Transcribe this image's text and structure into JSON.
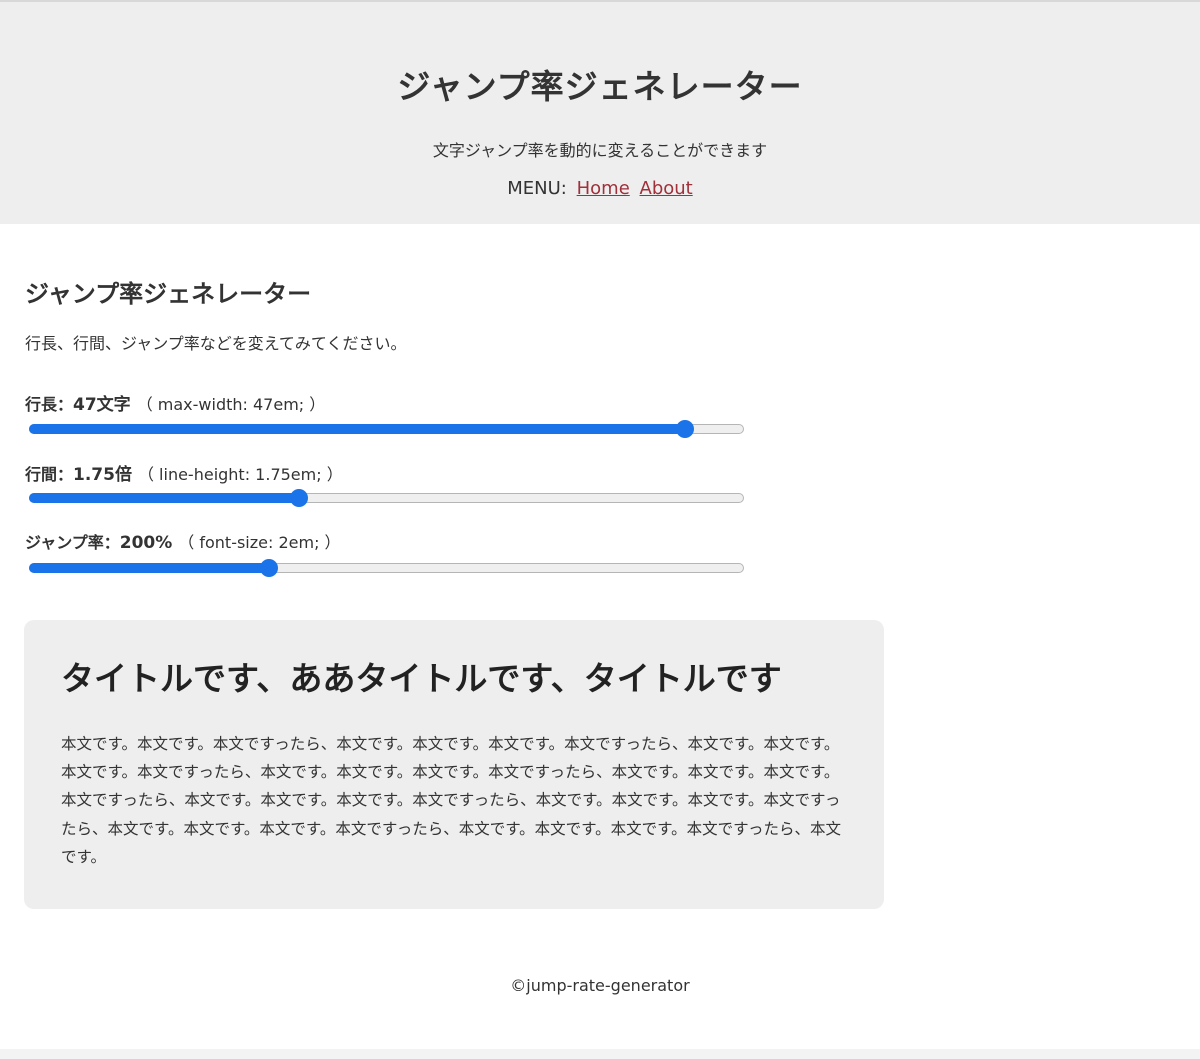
{
  "header": {
    "title": "ジャンプ率ジェネレーター",
    "description": "文字ジャンプ率を動的に変えることができます",
    "menu_label": "MENU:",
    "menu_items": [
      "Home",
      "About"
    ],
    "link_color": "#a0303a"
  },
  "main": {
    "heading": "ジャンプ率ジェネレーター",
    "intro": "行長、行間、ジャンプ率などを変えてみてください。",
    "controls": [
      {
        "label": "行長：",
        "value": "47文字",
        "code": "（ max-width: 47em; ）",
        "fraction": 0.917
      },
      {
        "label": "行間：",
        "value": "1.75倍",
        "code": "（ line-height: 1.75em; ）",
        "fraction": 0.377
      },
      {
        "label": "ジャンプ率：",
        "value": "200%",
        "code": "（ font-size: 2em; ）",
        "fraction": 0.336
      }
    ],
    "accent_color": "#1a73e8"
  },
  "preview": {
    "title": "タイトルです、ああタイトルです、タイトルです",
    "body": "本文です。本文です。本文ですったら、本文です。本文です。本文です。本文ですったら、本文です。本文です。本文です。本文ですったら、本文です。本文です。本文です。本文ですったら、本文です。本文です。本文です。本文ですったら、本文です。本文です。本文です。本文ですったら、本文です。本文です。本文です。本文ですったら、本文です。本文です。本文です。本文ですったら、本文です。本文です。本文です。本文ですったら、本文です。"
  },
  "footer": {
    "text": "©jump-rate-generator"
  }
}
